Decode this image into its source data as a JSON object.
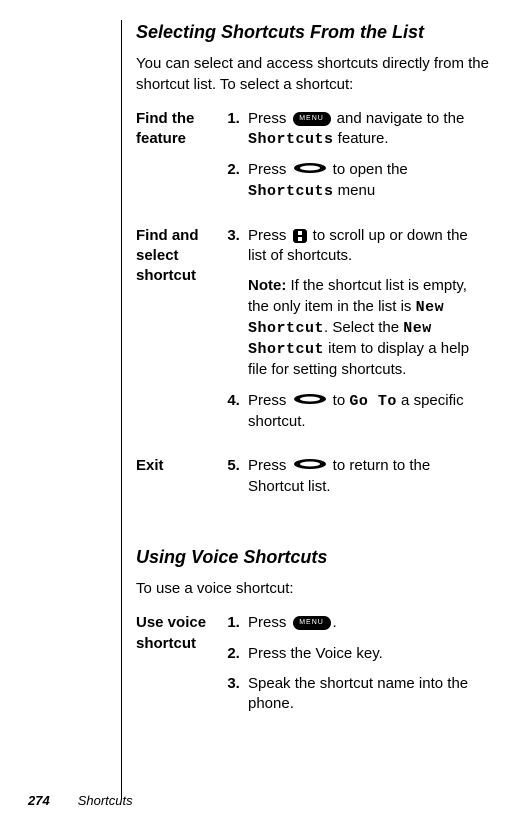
{
  "section1": {
    "title": "Selecting Shortcuts From the List",
    "intro": "You can select and access shortcuts directly from the shortcut list. To select a shortcut:",
    "rows": {
      "findFeature": {
        "label": "Find the feature",
        "step1a": "Press ",
        "step1b": " and navigate to the ",
        "step1c": " feature.",
        "step1mono": "Shortcuts",
        "step2a": "Press ",
        "step2b": " to open the ",
        "step2c": " menu",
        "step2mono": "Shortcuts"
      },
      "findShortcut": {
        "label": "Find and select shortcut",
        "step3a": "Press ",
        "step3b": " to scroll up or down the list of shortcuts.",
        "noteLabel": "Note:",
        "noteA": " If the shortcut list is empty, the only item in the list is ",
        "noteMono1": "New Shortcut",
        "noteB": ". Select the ",
        "noteMono2": "New Shortcut",
        "noteC": " item to display a help file for setting shortcuts.",
        "step4a": "Press ",
        "step4b": " to ",
        "step4mono": "Go To",
        "step4c": " a specific shortcut."
      },
      "exit": {
        "label": "Exit",
        "step5a": "Press ",
        "step5b": " to return to the Shortcut list."
      }
    }
  },
  "section2": {
    "title": "Using Voice Shortcuts",
    "intro": "To use a voice shortcut:",
    "row": {
      "label": "Use voice shortcut",
      "step1a": "Press ",
      "step1b": ".",
      "step2": "Press the Voice key.",
      "step3": "Speak the shortcut name into the phone."
    }
  },
  "keys": {
    "menu": "MENU"
  },
  "footer": {
    "page": "274",
    "chapter": "Shortcuts"
  }
}
